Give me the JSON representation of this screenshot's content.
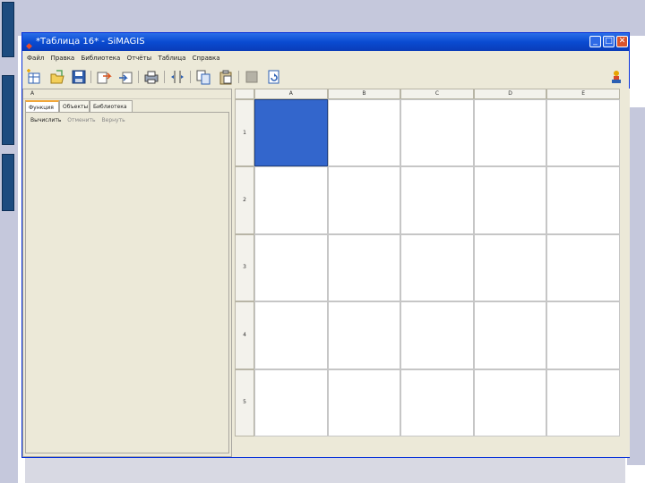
{
  "window": {
    "title": "*Таблица 16* - SiMAGIS",
    "min_label": "_",
    "max_label": "□",
    "close_label": "✕"
  },
  "menu": [
    "Файл",
    "Правка",
    "Библиотека",
    "Отчёты",
    "Таблица",
    "Справка"
  ],
  "toolbar": {
    "icons": [
      "new-table-icon",
      "open-icon",
      "save-icon",
      "import-icon",
      "export-icon",
      "print-icon",
      "columns-icon",
      "copy-icon",
      "paste-icon",
      "delete-icon",
      "refresh-icon",
      "help-icon"
    ]
  },
  "left_panel": {
    "header": "А",
    "tabs": [
      "Функция",
      "Объекты",
      "Библиотека"
    ],
    "active_tab": "Функция",
    "sub_tabs": [
      "Вычислить",
      "Отменить",
      "Вернуть"
    ]
  },
  "grid": {
    "columns": [
      "A",
      "B",
      "C",
      "D",
      "E"
    ],
    "rows": [
      "1",
      "2",
      "3",
      "4",
      "5"
    ],
    "selected_cell": "A1"
  },
  "colors": {
    "title_bar": "#0a4bd1",
    "selected_cell": "#3366cc",
    "slide_accent": "#1d4c7f"
  }
}
